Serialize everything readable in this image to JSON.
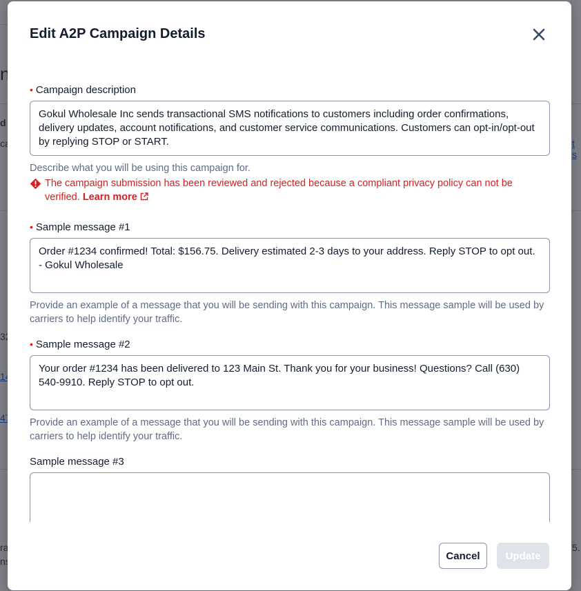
{
  "background": {
    "fragments": [
      "n",
      "d",
      "ca",
      "t s",
      "32",
      "14",
      "47",
      "ra",
      "ns",
      "5."
    ]
  },
  "modal": {
    "title": "Edit A2P Campaign Details",
    "close_icon": "close-icon",
    "fields": {
      "campaign_description": {
        "label": "Campaign description",
        "required": true,
        "value": "Gokul Wholesale Inc sends transactional SMS notifications to customers including order confirmations, delivery updates, account notifications, and customer service communications. Customers can opt-in/opt-out by replying STOP or START.",
        "help": "Describe what you will be using this campaign for.",
        "error": "The campaign submission has been reviewed and rejected because a compliant privacy policy can not be verified.",
        "error_link": "Learn more",
        "error_icon": "warning-diamond-icon",
        "link_icon": "external-link-icon"
      },
      "sample_1": {
        "label": "Sample message #1",
        "required": true,
        "value": "Order #1234 confirmed! Total: $156.75. Delivery estimated 2-3 days to your address. Reply STOP to opt out. - Gokul Wholesale",
        "help": "Provide an example of a message that you will be sending with this campaign. This message sample will be used by carriers to help identify your traffic."
      },
      "sample_2": {
        "label": "Sample message #2",
        "required": true,
        "value": "Your order #1234 has been delivered to 123 Main St. Thank you for your business! Questions? Call (630) 540-9910. Reply STOP to opt out.",
        "help": "Provide an example of a message that you will be sending with this campaign. This message sample will be used by carriers to help identify your traffic."
      },
      "sample_3": {
        "label": "Sample message #3",
        "required": false,
        "value": ""
      }
    },
    "footer": {
      "cancel_label": "Cancel",
      "update_label": "Update"
    }
  },
  "colors": {
    "overlay": "#7f8087",
    "error": "#d61f1f",
    "help_text": "#606b85",
    "border": "#8891aa",
    "disabled_button": "#e1e3ea"
  }
}
